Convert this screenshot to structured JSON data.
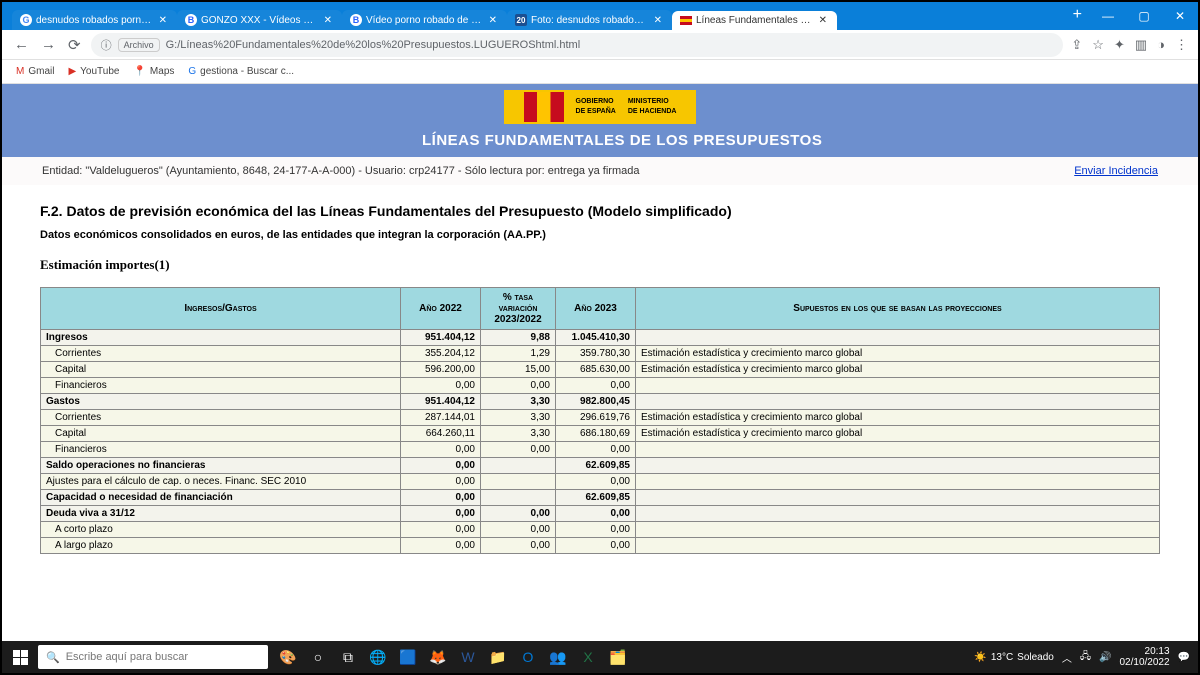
{
  "browser": {
    "tabs": [
      {
        "title": "desnudos robados porn - B",
        "favicon": "G",
        "fav_color": "#4285f4"
      },
      {
        "title": "GONZO XXX - Vídeos porno",
        "favicon": "B",
        "fav_color": "#2962ff"
      },
      {
        "title": "Vídeo porno robado de Me",
        "favicon": "B",
        "fav_color": "#2962ff"
      },
      {
        "title": "Foto: desnudos robados - e",
        "favicon": "20",
        "fav_color": "#1b4f91"
      },
      {
        "title": "Líneas Fundamentales de lo",
        "favicon": "flag"
      }
    ],
    "url_protocol": "Archivo",
    "url": "G:/Líneas%20Fundamentales%20de%20los%20Presupuestos.LUGUEROShtml.html"
  },
  "bookmarks": [
    {
      "label": "Gmail"
    },
    {
      "label": "YouTube"
    },
    {
      "label": "Maps"
    },
    {
      "label": "gestiona - Buscar c..."
    }
  ],
  "banner": {
    "gov1": "GOBIERNO",
    "gov2": "DE ESPAÑA",
    "min1": "MINISTERIO",
    "min2": "DE HACIENDA",
    "title": "LÍNEAS FUNDAMENTALES DE LOS PRESUPUESTOS"
  },
  "infoband": {
    "text": "Entidad: \"Valdelugueros\" (Ayuntamiento, 8648, 24-177-A-A-000) - Usuario: crp24177 - Sólo lectura por: entrega ya firmada",
    "link": "Enviar Incidencia"
  },
  "headings": {
    "section": "F.2. Datos de previsión económica del las Líneas Fundamentales del Presupuesto (Modelo simplificado)",
    "sub": "Datos económicos consolidados en euros, de las entidades que integran la corporación (AA.PP.)",
    "est": "Estimación importes(1)"
  },
  "table": {
    "headers": {
      "c0": "Ingresos/Gastos",
      "c1": "Año 2022",
      "c2": "% tasa variación 2023/2022",
      "c3": "Año 2023",
      "c4": "Supuestos en los que se basan las proyecciones"
    },
    "rows": [
      {
        "bold": true,
        "indent": false,
        "label": "Ingresos",
        "y2022": "951.404,12",
        "pct": "9,88",
        "y2023": "1.045.410,30",
        "sup": ""
      },
      {
        "bold": false,
        "indent": true,
        "label": "Corrientes",
        "y2022": "355.204,12",
        "pct": "1,29",
        "y2023": "359.780,30",
        "sup": "Estimación estadística y crecimiento marco global"
      },
      {
        "bold": false,
        "indent": true,
        "label": "Capital",
        "y2022": "596.200,00",
        "pct": "15,00",
        "y2023": "685.630,00",
        "sup": "Estimación estadística y crecimiento marco global"
      },
      {
        "bold": false,
        "indent": true,
        "label": "Financieros",
        "y2022": "0,00",
        "pct": "0,00",
        "y2023": "0,00",
        "sup": ""
      },
      {
        "bold": true,
        "indent": false,
        "label": "Gastos",
        "y2022": "951.404,12",
        "pct": "3,30",
        "y2023": "982.800,45",
        "sup": ""
      },
      {
        "bold": false,
        "indent": true,
        "label": "Corrientes",
        "y2022": "287.144,01",
        "pct": "3,30",
        "y2023": "296.619,76",
        "sup": "Estimación estadística y crecimiento marco global"
      },
      {
        "bold": false,
        "indent": true,
        "label": "Capital",
        "y2022": "664.260,11",
        "pct": "3,30",
        "y2023": "686.180,69",
        "sup": "Estimación estadística y crecimiento marco global"
      },
      {
        "bold": false,
        "indent": true,
        "label": "Financieros",
        "y2022": "0,00",
        "pct": "0,00",
        "y2023": "0,00",
        "sup": ""
      },
      {
        "bold": true,
        "indent": false,
        "label": "Saldo operaciones no financieras",
        "y2022": "0,00",
        "pct": "",
        "y2023": "62.609,85",
        "sup": ""
      },
      {
        "bold": false,
        "indent": false,
        "label": "Ajustes para el cálculo de cap. o neces. Financ. SEC 2010",
        "y2022": "0,00",
        "pct": "",
        "y2023": "0,00",
        "sup": ""
      },
      {
        "bold": true,
        "indent": false,
        "label": "Capacidad o necesidad de financiación",
        "y2022": "0,00",
        "pct": "",
        "y2023": "62.609,85",
        "sup": ""
      },
      {
        "bold": true,
        "indent": false,
        "label": "Deuda viva a 31/12",
        "y2022": "0,00",
        "pct": "0,00",
        "y2023": "0,00",
        "sup": ""
      },
      {
        "bold": false,
        "indent": true,
        "label": "A corto plazo",
        "y2022": "0,00",
        "pct": "0,00",
        "y2023": "0,00",
        "sup": ""
      },
      {
        "bold": false,
        "indent": true,
        "label": "A largo plazo",
        "y2022": "0,00",
        "pct": "0,00",
        "y2023": "0,00",
        "sup": ""
      }
    ]
  },
  "taskbar": {
    "search_placeholder": "Escribe aquí para buscar",
    "weather_temp": "13°C",
    "weather_desc": "Soleado",
    "time": "20:13",
    "date": "02/10/2022"
  }
}
